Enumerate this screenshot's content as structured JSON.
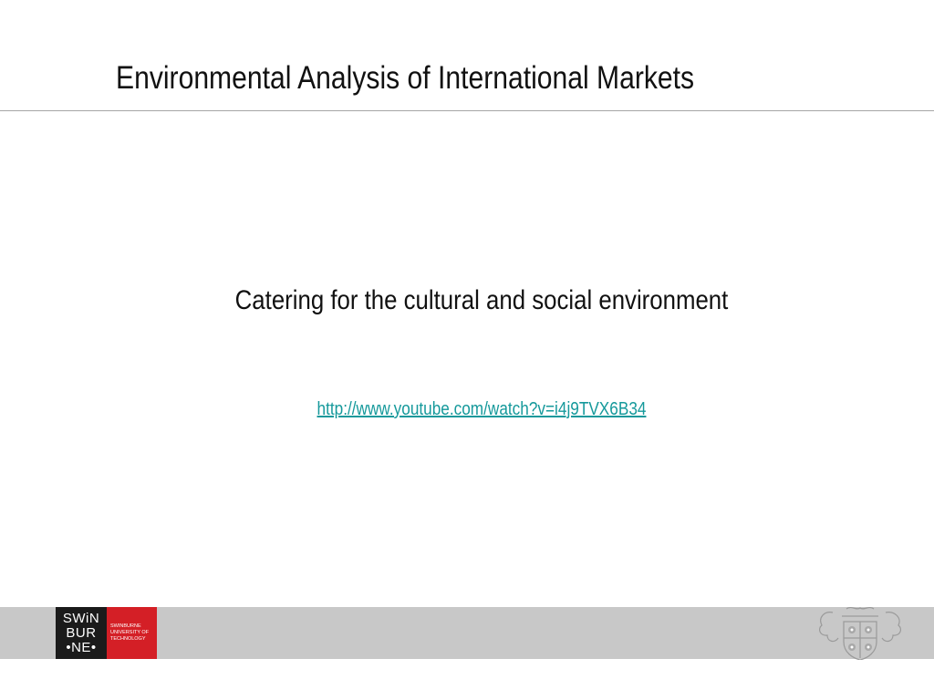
{
  "slide": {
    "title": "Environmental Analysis of International Markets",
    "subtitle": "Catering for the cultural and social environment",
    "link_text": "http://www.youtube.com/watch?v=i4j9TVX6B34"
  },
  "footer": {
    "logo": {
      "line1": "SWiN",
      "line2": "BUR",
      "line3": "•NE•",
      "red_line1": "SWINBURNE",
      "red_line2": "UNIVERSITY OF",
      "red_line3": "TECHNOLOGY"
    },
    "crest_icon": "university-crest-icon"
  },
  "colors": {
    "link": "#15999b",
    "footer_bar": "#c8c8c8",
    "logo_black": "#1b1b1b",
    "logo_red": "#d41f26",
    "rule": "#a6a6a6"
  }
}
